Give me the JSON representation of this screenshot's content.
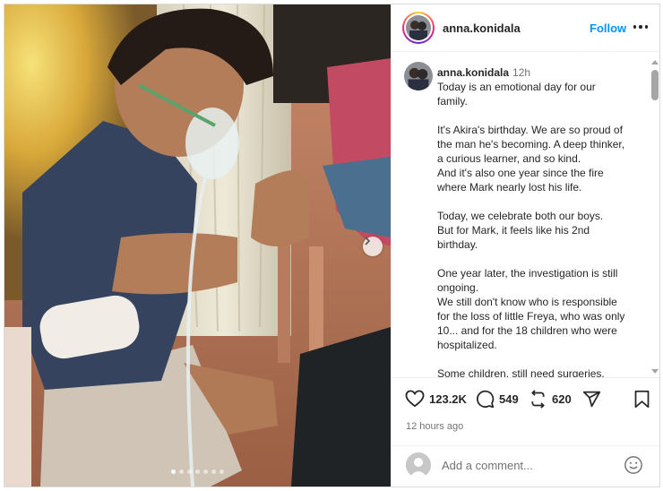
{
  "post": {
    "username": "anna.konidala",
    "follow_label": "Follow",
    "caption_time": "12h",
    "caption_paragraphs": [
      [
        "Today is an emotional day for our",
        "family."
      ],
      [
        "It's Akira's birthday. We are so proud of",
        "the man he's becoming. A deep thinker,",
        "a curious learner, and so kind.",
        "And it's also one year since the fire",
        "where Mark nearly lost his life."
      ],
      [
        "Today, we celebrate both our boys.",
        "But for Mark, it feels like his 2nd",
        "birthday."
      ],
      [
        "One year later, the investigation is still",
        "ongoing.",
        "We still don't know who is responsible",
        "for the loss of little Freya, who was only",
        "10... and for the 18 children who were",
        "hospitalized."
      ],
      [
        "Some children, still need surgeries."
      ]
    ],
    "likes": "123.2K",
    "comments_count": "549",
    "reposts": "620",
    "posted_ago": "12 hours ago",
    "comment_placeholder": "Add a comment..."
  },
  "carousel": {
    "total_slides": 7,
    "active_index": 0
  },
  "icons": {
    "like": "heart-icon",
    "comment": "comment-bubble-icon",
    "repost": "repost-icon",
    "share": "paper-plane-icon",
    "save": "bookmark-icon",
    "emoji": "smiley-icon",
    "next": "chevron-right-icon",
    "more": "more-options-icon"
  },
  "colors": {
    "link_blue": "#0095f6",
    "text": "#262626",
    "muted": "#737373",
    "border": "#dbdbdb"
  }
}
